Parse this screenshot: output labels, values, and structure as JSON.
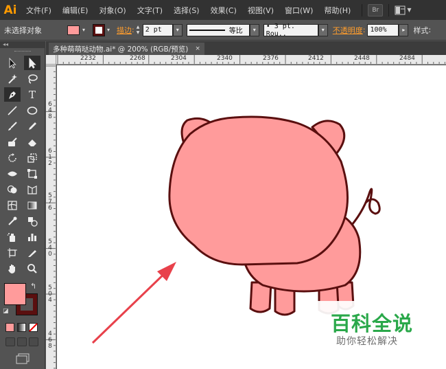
{
  "app": {
    "logo": "Ai",
    "menu": [
      "文件(F)",
      "编辑(E)",
      "对象(O)",
      "文字(T)",
      "选择(S)",
      "效果(C)",
      "视图(V)",
      "窗口(W)",
      "帮助(H)"
    ],
    "bridge_label": "Br"
  },
  "control_bar": {
    "selection_status": "未选择对象",
    "fill_color": "#ff9b9b",
    "stroke_color": "#5a0f0f",
    "stroke_label": "描边",
    "stroke_weight": "2 pt",
    "profile_label": "等比",
    "brush_value": "• 3 pt. Rou..",
    "opacity_label": "不透明度",
    "opacity_value": "100%",
    "style_label": "样式"
  },
  "toolbox": {
    "collapse_label": "◂◂",
    "fill_color": "#ff9b9b",
    "stroke_color": "#5a0f0f"
  },
  "document": {
    "tab_title": "多种萌萌哒动物.ai* @ 200% (RGB/预览)",
    "close_label": "×"
  },
  "rulers": {
    "top": [
      "2232",
      "2268",
      "2304",
      "2340",
      "2376",
      "2412",
      "2448",
      "2484"
    ],
    "left": [
      [
        "6",
        "4",
        "8"
      ],
      [
        "6",
        "1",
        "2"
      ],
      [
        "5",
        "7",
        "6"
      ],
      [
        "5",
        "4",
        "0"
      ],
      [
        "5",
        "0",
        "4"
      ],
      [
        "4",
        "6",
        "8"
      ]
    ]
  },
  "artwork": {
    "body_fill": "#ff9b9b",
    "outline": "#5a0f0f",
    "arrow_color": "#e8414b"
  },
  "watermark": {
    "title": "百科全说",
    "subtitle": "助你轻松解决",
    "title_color": "#2aa84a"
  }
}
